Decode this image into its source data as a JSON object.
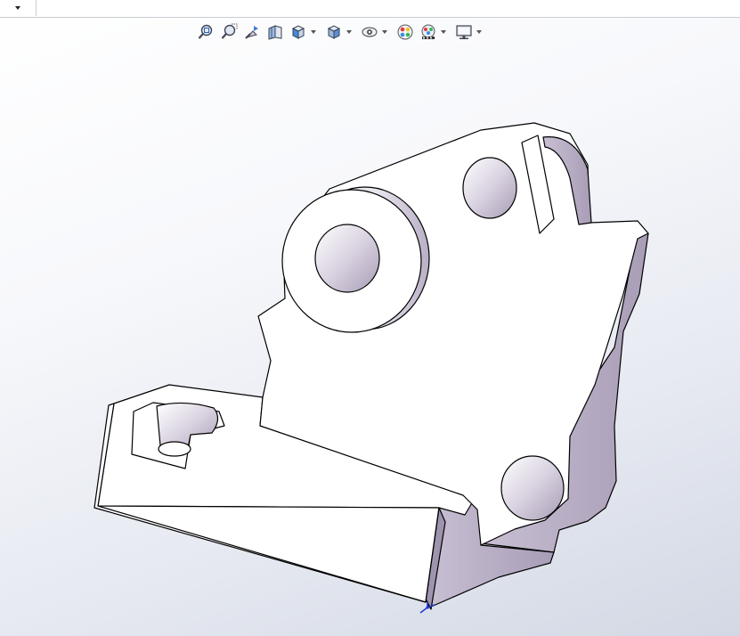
{
  "window": {
    "title": ""
  },
  "top_bar": {
    "dropdown_icon": "chevron-down-icon"
  },
  "heads_up_toolbar": {
    "tools": [
      {
        "name": "zoom-to-fit-icon",
        "has_dropdown": false
      },
      {
        "name": "zoom-to-area-icon",
        "has_dropdown": false
      },
      {
        "name": "previous-view-icon",
        "has_dropdown": false
      },
      {
        "name": "section-view-icon",
        "has_dropdown": false
      },
      {
        "name": "view-orientation-icon",
        "has_dropdown": true
      },
      {
        "name": "display-style-icon",
        "has_dropdown": true
      },
      {
        "name": "hide-show-items-icon",
        "has_dropdown": true
      },
      {
        "name": "edit-appearance-icon",
        "has_dropdown": false
      },
      {
        "name": "apply-scene-icon",
        "has_dropdown": true
      },
      {
        "name": "view-settings-icon",
        "has_dropdown": true
      }
    ]
  },
  "graphics_area": {
    "model": "3d-bracket-part",
    "background_colors": [
      "#ffffff",
      "#d3d8e4"
    ],
    "edge_color": "#000000",
    "face_color": "#ffffff",
    "shadow_face_color": "#b8aec4",
    "triad_icon": "origin-triad-icon"
  }
}
